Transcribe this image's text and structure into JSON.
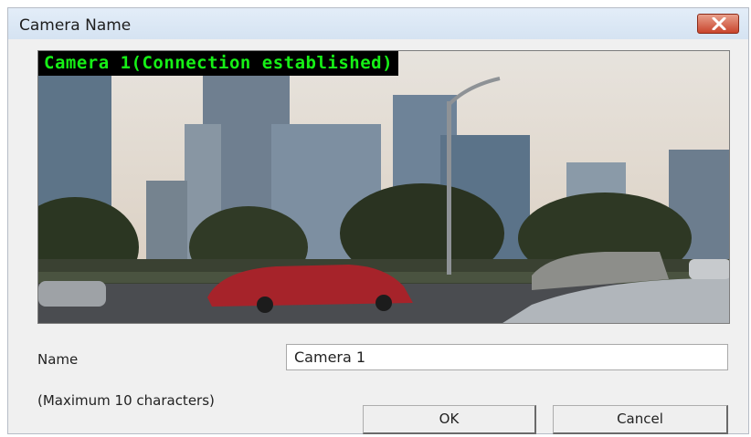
{
  "window": {
    "title": "Camera Name",
    "close_icon": "close-icon"
  },
  "video": {
    "overlay_text": "Camera 1(Connection established)"
  },
  "form": {
    "name_label": "Name",
    "name_value": "Camera 1",
    "hint": "(Maximum 10 characters)"
  },
  "buttons": {
    "ok": "OK",
    "cancel": "Cancel"
  },
  "colors": {
    "overlay_text": "#16f016",
    "close_button": "#c9452d"
  }
}
